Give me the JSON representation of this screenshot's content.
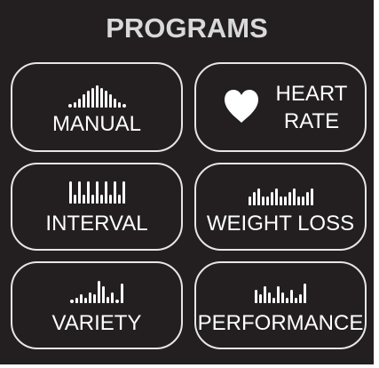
{
  "title": "PROGRAMS",
  "colors": {
    "panel_background": "#231f20",
    "button_border": "#e6e6e6",
    "title_text": "#d9d9d9",
    "button_text": "#ffffff"
  },
  "buttons": {
    "manual": {
      "label": "MANUAL",
      "icon": "manual-profile-icon"
    },
    "heart_rate": {
      "line1": "HEART",
      "line2": "RATE",
      "icon": "heart-icon"
    },
    "interval": {
      "label": "INTERVAL",
      "icon": "interval-profile-icon"
    },
    "weight_loss": {
      "label": "WEIGHT LOSS",
      "icon": "weight-loss-profile-icon"
    },
    "variety": {
      "label": "VARIETY",
      "icon": "variety-profile-icon"
    },
    "performance": {
      "label": "PERFORMANCE",
      "icon": "performance-profile-icon"
    }
  }
}
